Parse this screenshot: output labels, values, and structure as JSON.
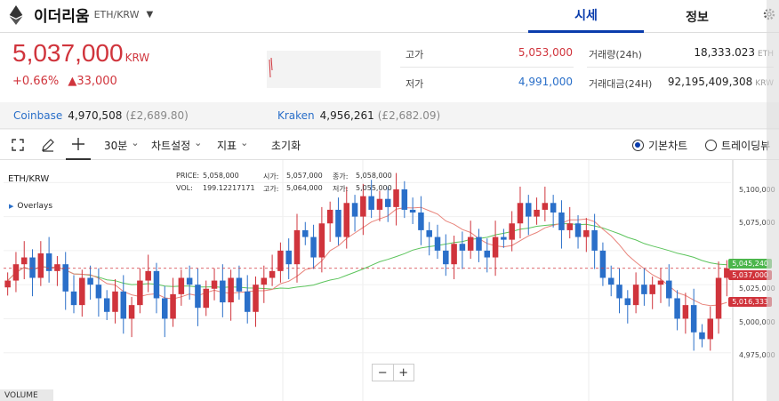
{
  "header": {
    "coin_name": "이더리움",
    "pair": "ETH/KRW",
    "tabs": [
      {
        "label": "시세",
        "active": true
      },
      {
        "label": "정보",
        "active": false
      }
    ]
  },
  "price": {
    "current": "5,037,000",
    "unit": "KRW",
    "change_pct": "+0.66%",
    "change_amt": "▲33,000",
    "color_up": "#d0343c",
    "color_down": "#2a6fc9"
  },
  "stats": {
    "high_label": "고가",
    "high": "5,053,000",
    "low_label": "저가",
    "low": "4,991,000",
    "volume_label": "거래량(24h)",
    "volume": "18,333.023",
    "volume_unit": "ETH",
    "value_label": "거래대금(24H)",
    "value": "92,195,409,308",
    "value_unit": "KRW"
  },
  "exchanges": [
    {
      "name": "Coinbase",
      "price": "4,970,508",
      "gbp": "(£2,689.80)"
    },
    {
      "name": "Kraken",
      "price": "4,956,261",
      "gbp": "(£2,682.09)"
    }
  ],
  "toolbar": {
    "interval": "30분",
    "chart_settings": "차트설정",
    "indicators": "지표",
    "reset": "초기화",
    "basic_chart": "기본차트",
    "trading_view": "트레이딩뷰"
  },
  "chart": {
    "pair_label": "ETH/KRW",
    "overlays_label": "Overlays",
    "ohlc": {
      "price_label": "PRICE:",
      "price": "5,058,000",
      "open_label": "시가:",
      "open": "5,057,000",
      "close_label": "종가:",
      "close": "5,058,000",
      "vol_label": "VOL:",
      "vol": "199.12217171",
      "high_label": "고가:",
      "high": "5,064,000",
      "low_label": "저가:",
      "low": "5,055,000"
    },
    "y_ticks": [
      "5,100,000",
      "5,075,000",
      "5,050,000",
      "5,025,000",
      "5,000,000",
      "4,975,000"
    ],
    "labels": {
      "ma_green": "5,045,240",
      "current": "5,037,000",
      "ma_red": "5,016,333"
    },
    "volume_label": "VOLUME",
    "zoom_out": "−",
    "zoom_in": "+",
    "colors": {
      "up": "#d0343c",
      "down": "#2a6fc9",
      "ma_long": "#5cc45c",
      "ma_short": "#e8837a"
    }
  },
  "chart_data": {
    "type": "candlestick",
    "ylim": [
      4950000,
      5110000
    ],
    "close_series": [
      5028000,
      5040000,
      5045000,
      5030000,
      5048000,
      5035000,
      5040000,
      5020000,
      5010000,
      5030000,
      5025000,
      5015000,
      5005000,
      5020000,
      5000000,
      5010000,
      5028000,
      5035000,
      5015000,
      5000000,
      5018000,
      5030000,
      5025000,
      5008000,
      5022000,
      5028000,
      5012000,
      5030000,
      5020000,
      5005000,
      5025000,
      5030000,
      5035000,
      5050000,
      5040000,
      5065000,
      5060000,
      5045000,
      5070000,
      5080000,
      5060000,
      5085000,
      5075000,
      5090000,
      5080000,
      5088000,
      5082000,
      5095000,
      5080000,
      5078000,
      5065000,
      5060000,
      5050000,
      5040000,
      5055000,
      5050000,
      5060000,
      5050000,
      5045000,
      5060000,
      5058000,
      5070000,
      5085000,
      5075000,
      5080000,
      5085000,
      5078000,
      5065000,
      5070000,
      5060000,
      5065000,
      5050000,
      5030000,
      5025000,
      5015000,
      5010000,
      5025000,
      5018000,
      5025000,
      5028000,
      5015000,
      5000000,
      5010000,
      4990000,
      4985000,
      5000000,
      5030000,
      5037000
    ]
  }
}
